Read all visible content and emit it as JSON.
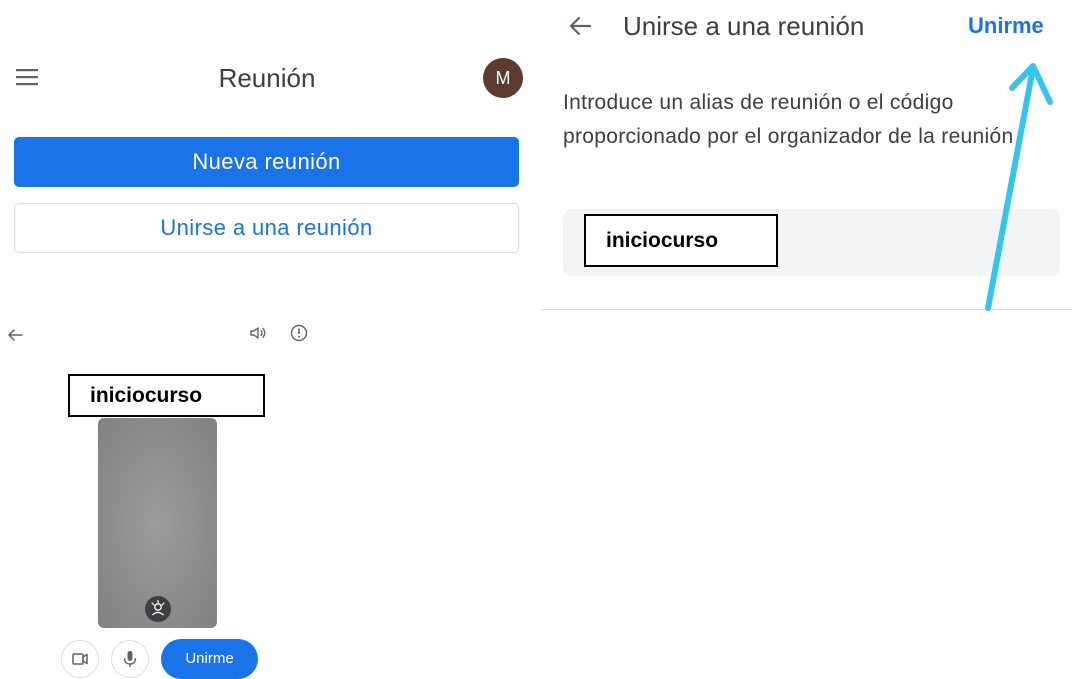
{
  "panel_home": {
    "title": "Reunión",
    "avatar_letter": "M",
    "new_meeting_label": "Nueva reunión",
    "join_meeting_label": "Unirse a una reunión",
    "icons": {
      "menu": "hamburger-menu-icon"
    }
  },
  "panel_join": {
    "title": "Unirse a una reunión",
    "action_label": "Unirme",
    "instructions": "Introduce un alias de reunión o el código proporcionado por el organizador de la reunión",
    "code_value": "iniciocurso",
    "icons": {
      "back": "arrow-back-icon",
      "annotation": "cyan-pointer-arrow"
    }
  },
  "panel_preview": {
    "code_value": "iniciocurso",
    "join_label": "Unirme",
    "icons": {
      "back": "arrow-back-icon",
      "audio": "volume-icon",
      "info": "info-icon",
      "effects": "background-effects-icon",
      "camera": "video-camera-icon",
      "mic": "microphone-icon"
    }
  },
  "colors": {
    "accent": "#1a73e8",
    "avatar": "#5d3b30",
    "annotation_arrow": "#36c4ea",
    "field_background": "#f1f3f4"
  }
}
